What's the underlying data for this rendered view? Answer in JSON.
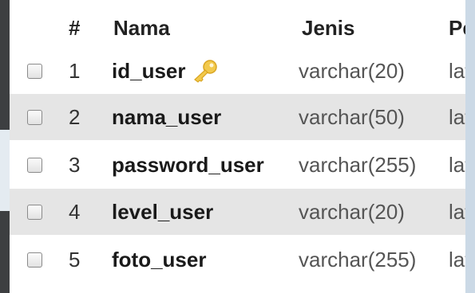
{
  "table": {
    "headers": {
      "number": "#",
      "name": "Nama",
      "type": "Jenis",
      "collation": "Pe"
    },
    "rows": [
      {
        "number": "1",
        "name": "id_user",
        "type": "varchar(20)",
        "collation": "lat",
        "primary_key": true
      },
      {
        "number": "2",
        "name": "nama_user",
        "type": "varchar(50)",
        "collation": "lat",
        "primary_key": false
      },
      {
        "number": "3",
        "name": "password_user",
        "type": "varchar(255)",
        "collation": "lat",
        "primary_key": false
      },
      {
        "number": "4",
        "name": "level_user",
        "type": "varchar(20)",
        "collation": "lat",
        "primary_key": false
      },
      {
        "number": "5",
        "name": "foto_user",
        "type": "varchar(255)",
        "collation": "lat",
        "primary_key": false
      }
    ]
  },
  "icons": {
    "primary_key": "key-icon",
    "row_select": "checkbox"
  },
  "colors": {
    "row_alt": "#e5e5e5",
    "key_icon": "#f2c94c"
  }
}
